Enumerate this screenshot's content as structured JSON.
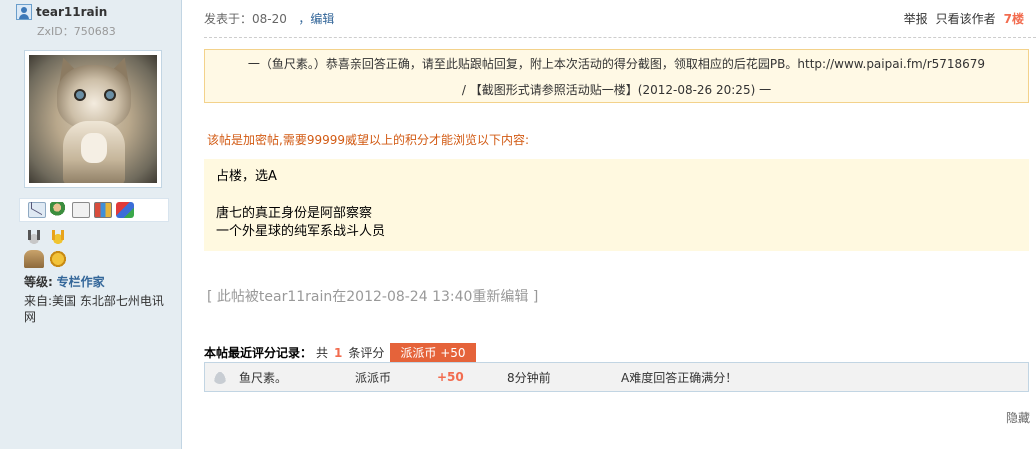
{
  "user": {
    "name": "tear11rain",
    "zxid": "ZxID：750683",
    "level_label": "等级:",
    "level_value": "专栏作家",
    "from": "来自:美国 东北部七州电讯网"
  },
  "post": {
    "posted_at": "发表于：08-20",
    "edit_link": "，编辑",
    "report": "举报",
    "only_author": "只看该作者",
    "floor": "7楼"
  },
  "notice": {
    "line1": "一（鱼尺素。）恭喜亲回答正确，请至此贴跟帖回复，附上本次活动的得分截图，领取相应的后花园PB。http://www.paipai.fm/r5718679",
    "line2": "/ 【截图形式请参照活动贴一楼】(2012-08-26 20:25) 一"
  },
  "encrypt_note": "该帖是加密帖,需要99999威望以上的积分才能浏览以下内容:",
  "content": {
    "line1": "占楼，选A",
    "line2": "唐七的真正身份是阿部察察",
    "line3": "一个外星球的纯军系战斗人员"
  },
  "edit_note": "[ 此帖被tear11rain在2012-08-24 13:40重新编辑 ]",
  "rating": {
    "title": "本帖最近评分记录：",
    "prefix": "共",
    "count": "1",
    "suffix": "条评分",
    "tag": "派派币 +50",
    "rows": [
      {
        "user": "鱼尺素。",
        "type": "派派币",
        "score": "+50",
        "time": "8分钟前",
        "reason": "A难度回答正确满分！"
      }
    ]
  },
  "hide": "隐藏",
  "icons": [
    "user-icon",
    "message-icon",
    "add-friend-icon",
    "profile-icon",
    "card-icon",
    "blocks-icon"
  ],
  "colors": {
    "accent": "#f26c4f",
    "link": "#336699",
    "sidebar_bg": "#e5edf2",
    "notice_bg": "#fff9e5"
  }
}
